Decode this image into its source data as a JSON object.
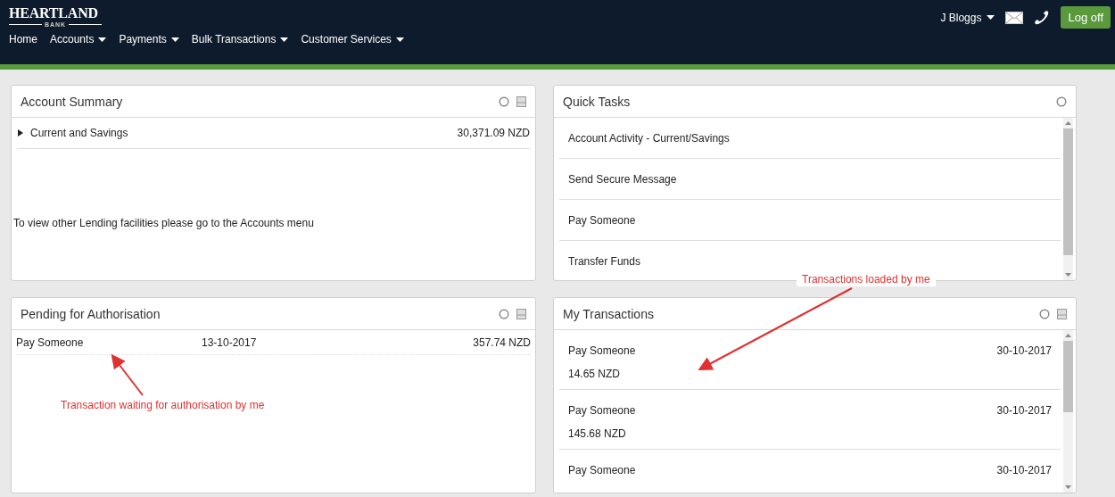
{
  "header": {
    "logo": {
      "name": "HEARTLAND",
      "sub": "BANK"
    },
    "nav": [
      {
        "label": "Home",
        "dropdown": false
      },
      {
        "label": "Accounts",
        "dropdown": true
      },
      {
        "label": "Payments",
        "dropdown": true
      },
      {
        "label": "Bulk Transactions",
        "dropdown": true
      },
      {
        "label": "Customer Services",
        "dropdown": true
      }
    ],
    "user": "J Bloggs",
    "logoff": "Log off"
  },
  "account_summary": {
    "title": "Account Summary",
    "rows": [
      {
        "name": "Current and Savings",
        "amount": "30,371.09 NZD",
        "expanded": false
      }
    ],
    "note": "To view other Lending facilities please go to the Accounts menu"
  },
  "quick_tasks": {
    "title": "Quick Tasks",
    "items": [
      "Account Activity - Current/Savings",
      "Send Secure Message",
      "Pay Someone",
      "Transfer Funds"
    ]
  },
  "pending": {
    "title": "Pending for Authorisation",
    "rows": [
      {
        "type": "Pay Someone",
        "date": "13-10-2017",
        "amount": "357.74 NZD"
      }
    ]
  },
  "my_transactions": {
    "title": "My Transactions",
    "items": [
      {
        "type": "Pay Someone",
        "date": "30-10-2017",
        "amount": "14.65 NZD"
      },
      {
        "type": "Pay Someone",
        "date": "30-10-2017",
        "amount": "145.68 NZD"
      },
      {
        "type": "Pay Someone",
        "date": "30-10-2017"
      }
    ]
  },
  "annotations": [
    "Transaction waiting for authorisation by me",
    "Transactions loaded by me"
  ]
}
